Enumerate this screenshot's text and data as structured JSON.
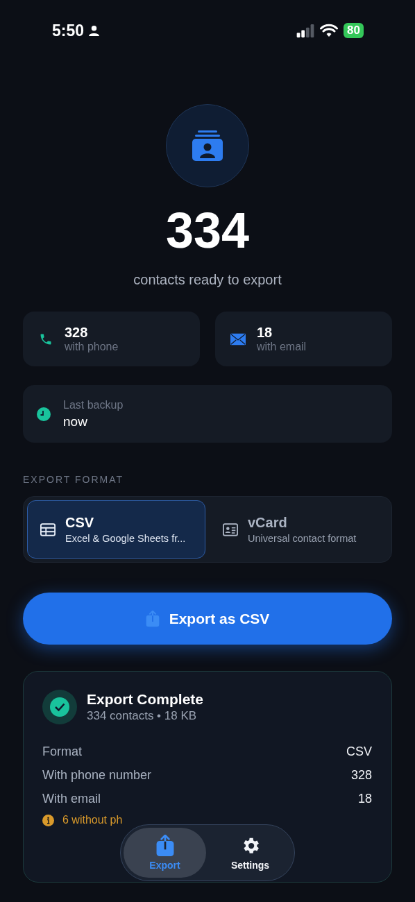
{
  "status_bar": {
    "time": "5:50",
    "battery": "80"
  },
  "hero": {
    "count": "334",
    "caption": "contacts ready to export"
  },
  "stats": [
    {
      "kind": "phone",
      "value": "328",
      "label": "with phone"
    },
    {
      "kind": "email",
      "value": "18",
      "label": "with email"
    }
  ],
  "backup": {
    "label": "Last backup",
    "value": "now"
  },
  "export_format": {
    "heading": "EXPORT FORMAT",
    "options": [
      {
        "kind": "table",
        "title": "CSV",
        "subtitle": "Excel & Google Sheets fr...",
        "selected": true
      },
      {
        "kind": "card",
        "title": "vCard",
        "subtitle": "Universal contact format",
        "selected": false
      }
    ]
  },
  "export_button": {
    "label": "Export as CSV"
  },
  "result": {
    "title": "Export Complete",
    "subtitle": "334 contacts • 18 KB",
    "rows": [
      {
        "label": "Format",
        "value": "CSV"
      },
      {
        "label": "With phone number",
        "value": "328"
      },
      {
        "label": "With email",
        "value": "18"
      }
    ],
    "warning": "6 without ph"
  },
  "tab_bar": [
    {
      "kind": "export",
      "label": "Export",
      "selected": true
    },
    {
      "kind": "settings",
      "label": "Settings",
      "selected": false
    }
  ]
}
